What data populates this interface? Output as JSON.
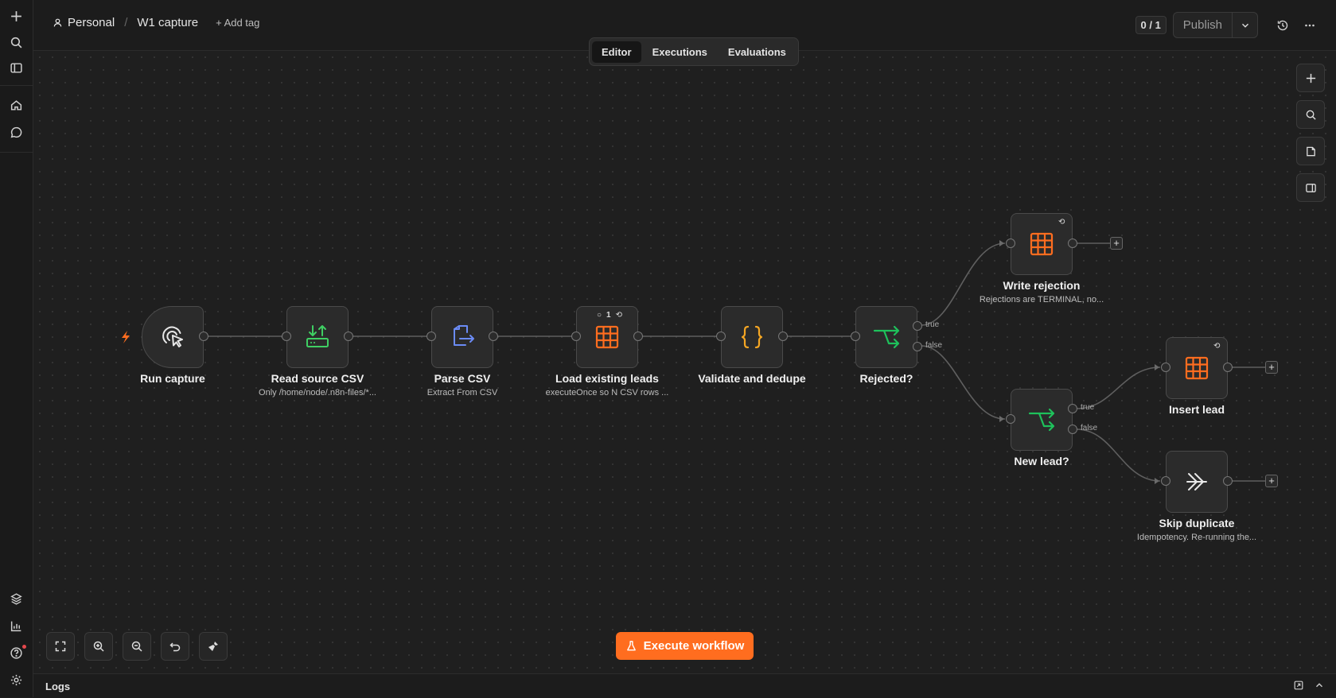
{
  "header": {
    "project": "Personal",
    "workflow_name": "W1 capture",
    "add_tag": "+ Add tag",
    "counter": "0 / 1",
    "publish_label": "Publish"
  },
  "tabs": [
    "Editor",
    "Executions",
    "Evaluations"
  ],
  "active_tab": "Editor",
  "nodes": {
    "run_capture": {
      "title": "Run capture",
      "subtitle": ""
    },
    "read_csv": {
      "title": "Read source CSV",
      "subtitle": "Only /home/node/.n8n-files/*..."
    },
    "parse_csv": {
      "title": "Parse CSV",
      "subtitle": "Extract From CSV"
    },
    "load_leads": {
      "title": "Load existing leads",
      "subtitle": "executeOnce so N CSV rows ...",
      "badge": "1"
    },
    "validate": {
      "title": "Validate and dedupe",
      "subtitle": ""
    },
    "rejected": {
      "title": "Rejected?",
      "subtitle": ""
    },
    "write_rejection": {
      "title": "Write rejection",
      "subtitle": "Rejections are TERMINAL, no..."
    },
    "new_lead": {
      "title": "New lead?",
      "subtitle": ""
    },
    "insert_lead": {
      "title": "Insert lead",
      "subtitle": ""
    },
    "skip_duplicate": {
      "title": "Skip duplicate",
      "subtitle": "Idempotency. Re-running the..."
    }
  },
  "branch_labels": {
    "true": "true",
    "false": "false"
  },
  "execute_label": "Execute workflow",
  "logs_label": "Logs",
  "colors": {
    "accent": "#ff6d1f",
    "table": "#ff6d1f",
    "if": "#1ec15b",
    "code": "#f5a623",
    "extract": "#6b8bf5",
    "file": "#3fcf63"
  }
}
